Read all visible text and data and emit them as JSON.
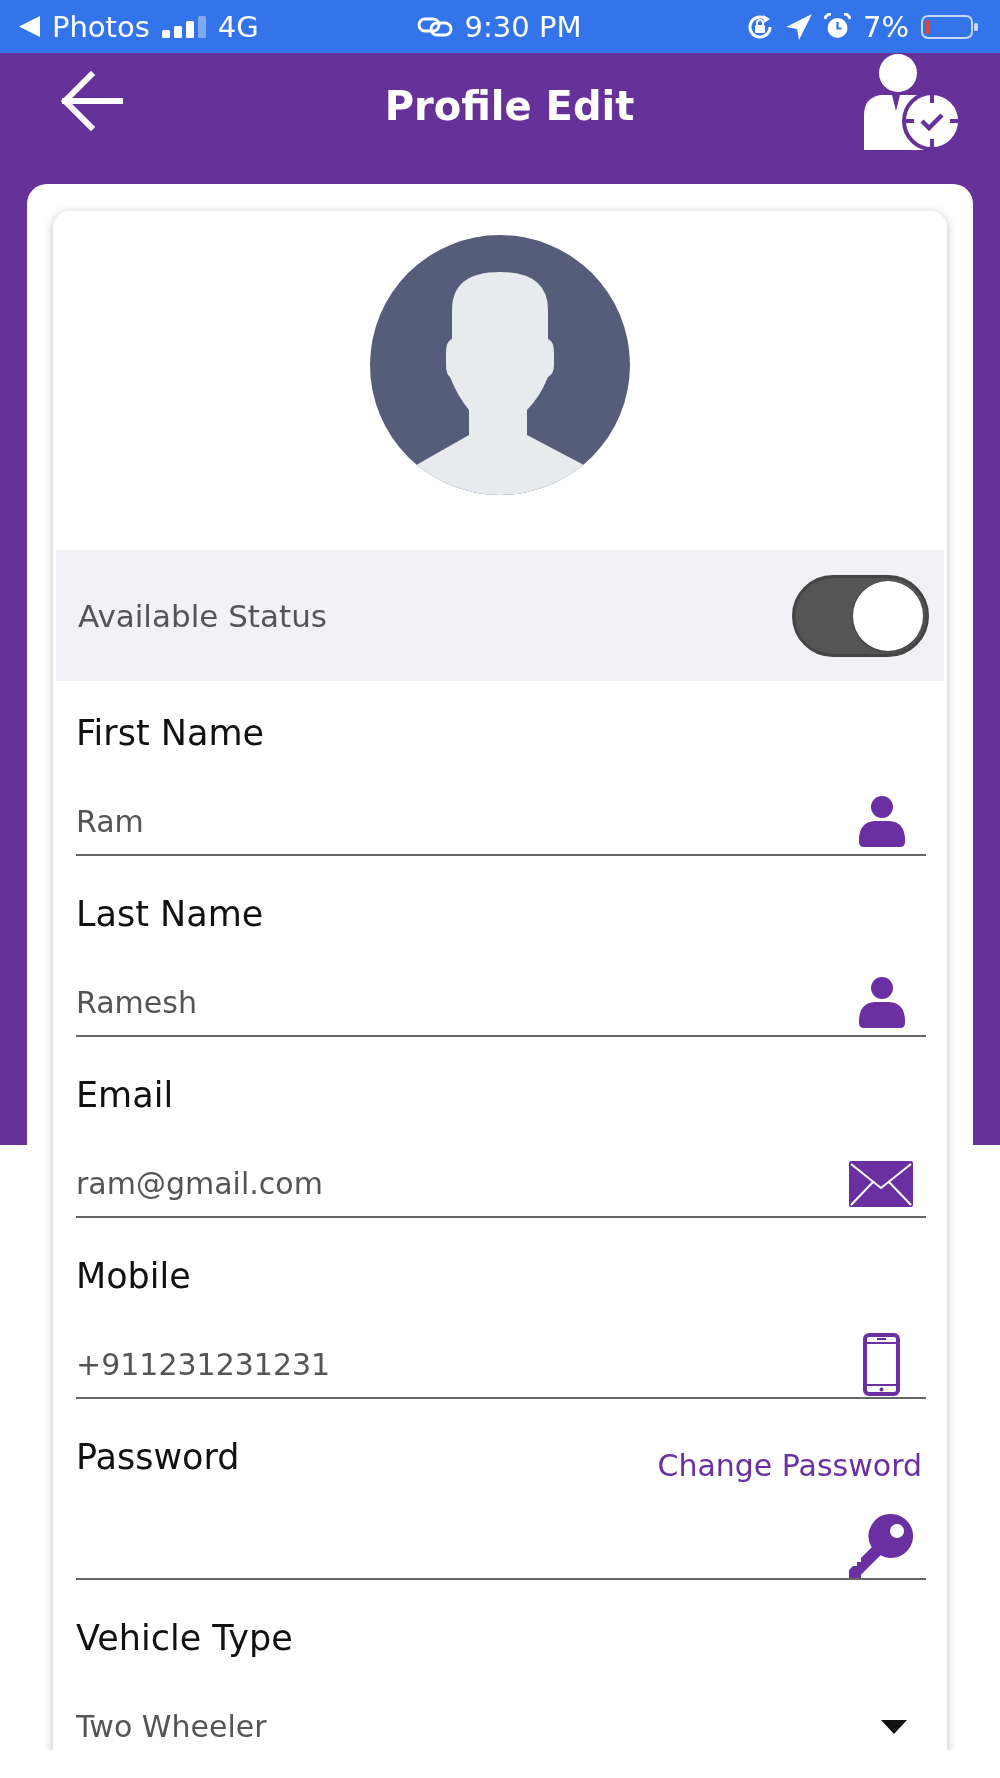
{
  "status_bar": {
    "back_app": "Photos",
    "network": "4G",
    "time": "9:30 PM",
    "battery": "7%"
  },
  "header": {
    "title": "Profile Edit"
  },
  "profile": {
    "status_label": "Available Status",
    "available": true
  },
  "fields": [
    {
      "kind": "name",
      "label": "First Name",
      "value": "Ram"
    },
    {
      "kind": "name",
      "label": "Last Name",
      "value": "Ramesh"
    },
    {
      "kind": "email",
      "label": "Email",
      "value": "ram@gmail.com"
    },
    {
      "kind": "mobile",
      "label": "Mobile",
      "value": "+911231231231"
    },
    {
      "kind": "password",
      "label": "Password",
      "link": "Change Password"
    },
    {
      "kind": "select",
      "label": "Vehicle Type",
      "value": "Two Wheeler"
    }
  ]
}
